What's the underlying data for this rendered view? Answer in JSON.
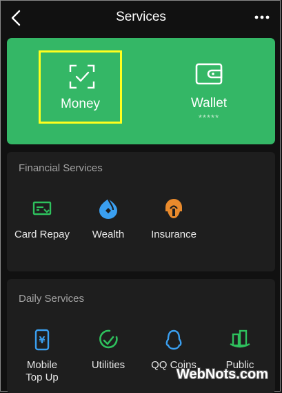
{
  "header": {
    "title": "Services"
  },
  "pay": {
    "money_label": "Money",
    "wallet_label": "Wallet",
    "wallet_balance_masked": "*****",
    "accent": "#34b766",
    "highlight": "#ffff1e"
  },
  "financial": {
    "title": "Financial Services",
    "items": [
      {
        "label": "Card Repay",
        "icon": "card-icon"
      },
      {
        "label": "Wealth",
        "icon": "wealth-icon"
      },
      {
        "label": "Insurance",
        "icon": "insurance-icon"
      }
    ]
  },
  "daily": {
    "title": "Daily Services",
    "items": [
      {
        "label": "Mobile\nTop Up",
        "icon": "mobile-topup-icon"
      },
      {
        "label": "Utilities",
        "icon": "utilities-icon"
      },
      {
        "label": "QQ Coins",
        "icon": "qq-coins-icon"
      },
      {
        "label": "Public",
        "icon": "public-icon"
      }
    ]
  },
  "watermark": "WebNots.com"
}
